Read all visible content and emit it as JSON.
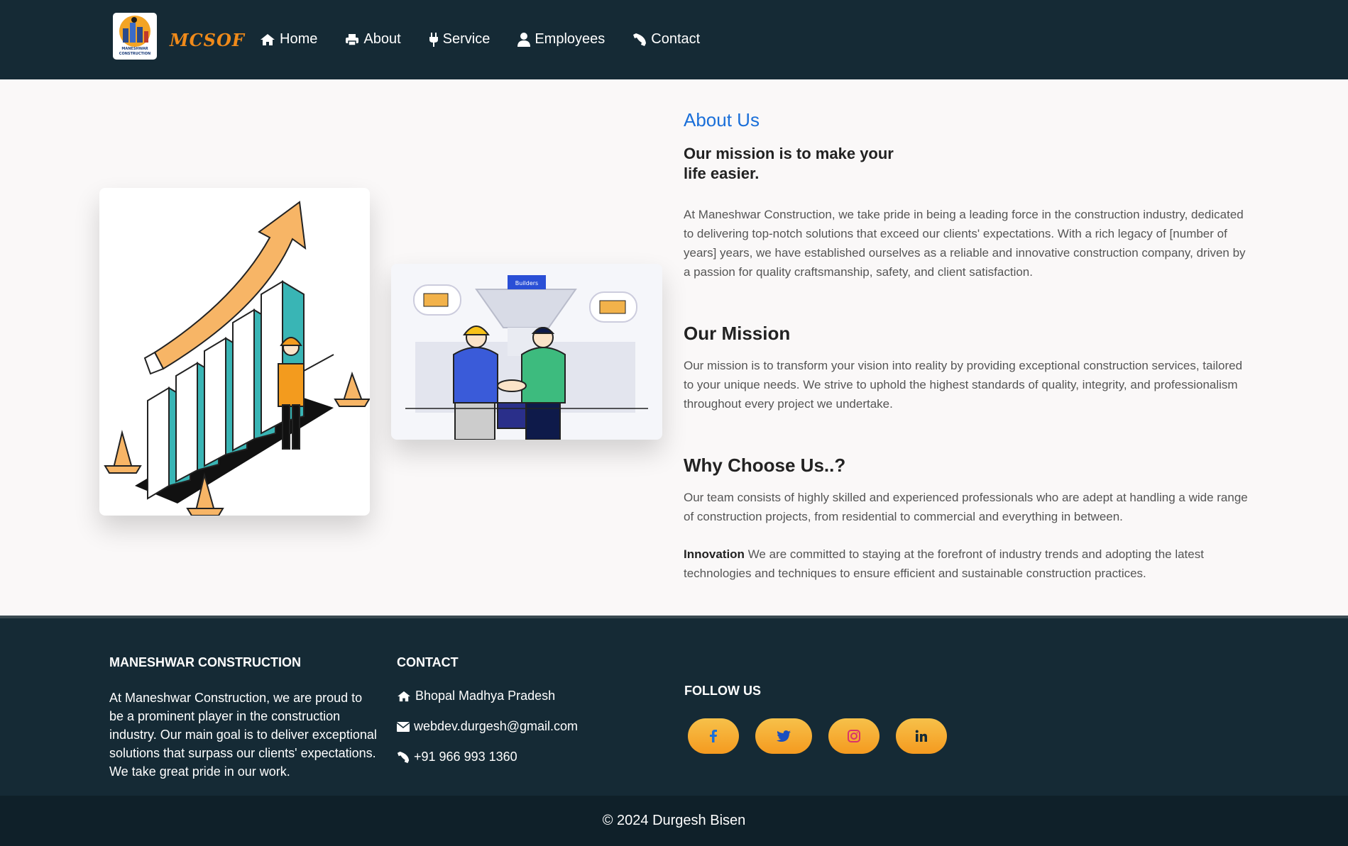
{
  "navbar": {
    "brand": "MCSOF",
    "logo_text": "MANESHWAR CONSTRUCTION",
    "links": [
      {
        "label": "Home",
        "icon": "home-icon"
      },
      {
        "label": "About",
        "icon": "print-icon"
      },
      {
        "label": "Service",
        "icon": "plug-icon"
      },
      {
        "label": "Employees",
        "icon": "user-icon"
      },
      {
        "label": "Contact",
        "icon": "phone-icon"
      }
    ]
  },
  "main": {
    "about_title": "About Us",
    "mission_heading": "Our mission is to make your life easier.",
    "intro": "At Maneshwar Construction, we take pride in being a leading force in the construction industry, dedicated to delivering top-notch solutions that exceed our clients' expectations. With a rich legacy of [number of years] years, we have established ourselves as a reliable and innovative construction company, driven by a passion for quality craftsmanship, safety, and client satisfaction.",
    "mission_title": "Our Mission",
    "mission_text": "Our mission is to transform your vision into reality by providing exceptional construction services, tailored to your unique needs. We strive to uphold the highest standards of quality, integrity, and professionalism throughout every project we undertake.",
    "why_title": "Why Choose Us..?",
    "why_text": "Our team consists of highly skilled and experienced professionals who are adept at handling a wide range of construction projects, from residential to commercial and everything in between.",
    "innovation_label": "Innovation",
    "innovation_text": "We are committed to staying at the forefront of industry trends and adopting the latest technologies and techniques to ensure efficient and sustainable construction practices.",
    "illustration_badge": "Builders"
  },
  "footer": {
    "company_title": "MANESHWAR CONSTRUCTION",
    "company_text": "At Maneshwar Construction, we are proud to be a prominent player in the construction industry. Our main goal is to deliver exceptional solutions that surpass our clients' expectations. We take great pride in our work.",
    "contact_title": "CONTACT",
    "address": "Bhopal Madhya Pradesh",
    "email": "webdev.durgesh@gmail.com",
    "phone": "+91 966 993 1360",
    "follow_title": "FOLLOW US",
    "socials": [
      {
        "name": "facebook",
        "icon": "facebook-icon"
      },
      {
        "name": "twitter",
        "icon": "twitter-icon"
      },
      {
        "name": "instagram",
        "icon": "instagram-icon"
      },
      {
        "name": "linkedin",
        "icon": "linkedin-icon"
      }
    ],
    "copyright": "© 2024 Durgesh Bisen"
  },
  "colors": {
    "navbar_bg": "#152a35",
    "accent_blue": "#1a6fd9",
    "brand_orange": "#f08a1a",
    "social_gradient": "#f6c14a"
  }
}
